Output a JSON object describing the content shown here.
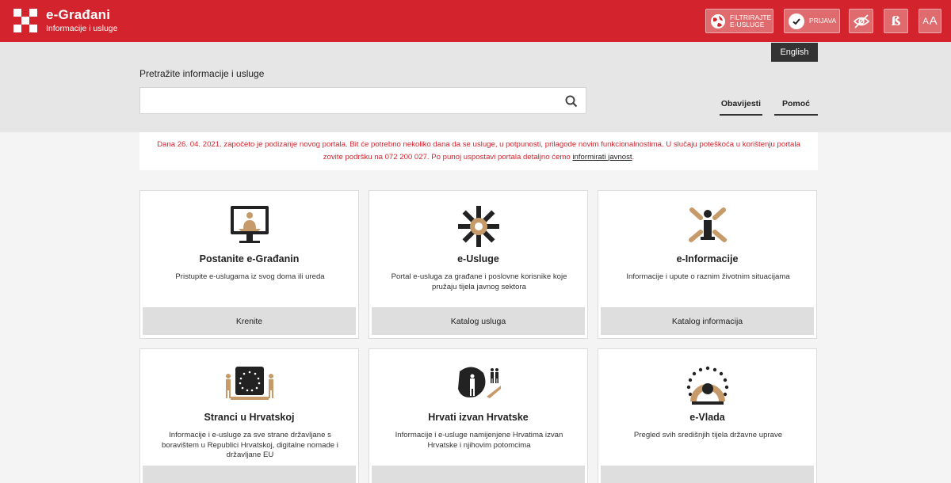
{
  "header": {
    "title": "e-Građani",
    "subtitle": "Informacije i usluge",
    "filter_label_1": "FILTRIRAJTE",
    "filter_label_2": "E-USLUGE",
    "login_label": "PRIJAVA",
    "font_glyph": "ß",
    "aa_small": "A",
    "aa_big": "A"
  },
  "language": {
    "label": "English"
  },
  "search": {
    "label": "Pretražite informacije i usluge",
    "value": "",
    "placeholder": ""
  },
  "tabs": [
    {
      "label": "Obavijesti"
    },
    {
      "label": "Pomoć"
    }
  ],
  "notice": {
    "text": "Dana 26. 04. 2021. započeto je podizanje novog portala. Bit će potrebno nekoliko dana da se usluge, u potpunosti, prilagode novim funkcionalnostima. U slučaju poteškoća u korištenju portala zovite podršku na 072 200 027. Po punoj uspostavi portala detaljno ćemo ",
    "link": "informirati javnost",
    "end": "."
  },
  "cards": [
    {
      "icon": "person-at-computer-icon",
      "title": "Postanite e-Građanin",
      "description": "Pristupite e-uslugama iz svog doma ili ureda",
      "cta": "Krenite"
    },
    {
      "icon": "e-services-star-icon",
      "title": "e-Usluge",
      "description": "Portal e-usluga za građane i poslovne korisnike koje pružaju tijela javnog sektora",
      "cta": "Katalog usluga"
    },
    {
      "icon": "information-person-icon",
      "title": "e-Informacije",
      "description": "Informacije i upute o raznim životnim situacijama",
      "cta": "Katalog informacija"
    },
    {
      "icon": "eu-flag-people-icon",
      "title": "Stranci u Hrvatskoj",
      "description": "Informacije i e-usluge za sve strane državljane s boravištem u Republici Hrvatskoj, digitalne nomade i državljane EU",
      "cta": ""
    },
    {
      "icon": "croats-abroad-icon",
      "title": "Hrvati izvan Hrvatske",
      "description": "Informacije i e-usluge namijenjene Hrvatima izvan Hrvatske i njihovim potomcima",
      "cta": ""
    },
    {
      "icon": "government-circle-icon",
      "title": "e-Vlada",
      "description": "Pregled svih središnjih tijela državne uprave",
      "cta": ""
    }
  ],
  "colors": {
    "brand_red": "#d3232d",
    "accent_tan": "#c79a6a",
    "dark": "#222222"
  }
}
